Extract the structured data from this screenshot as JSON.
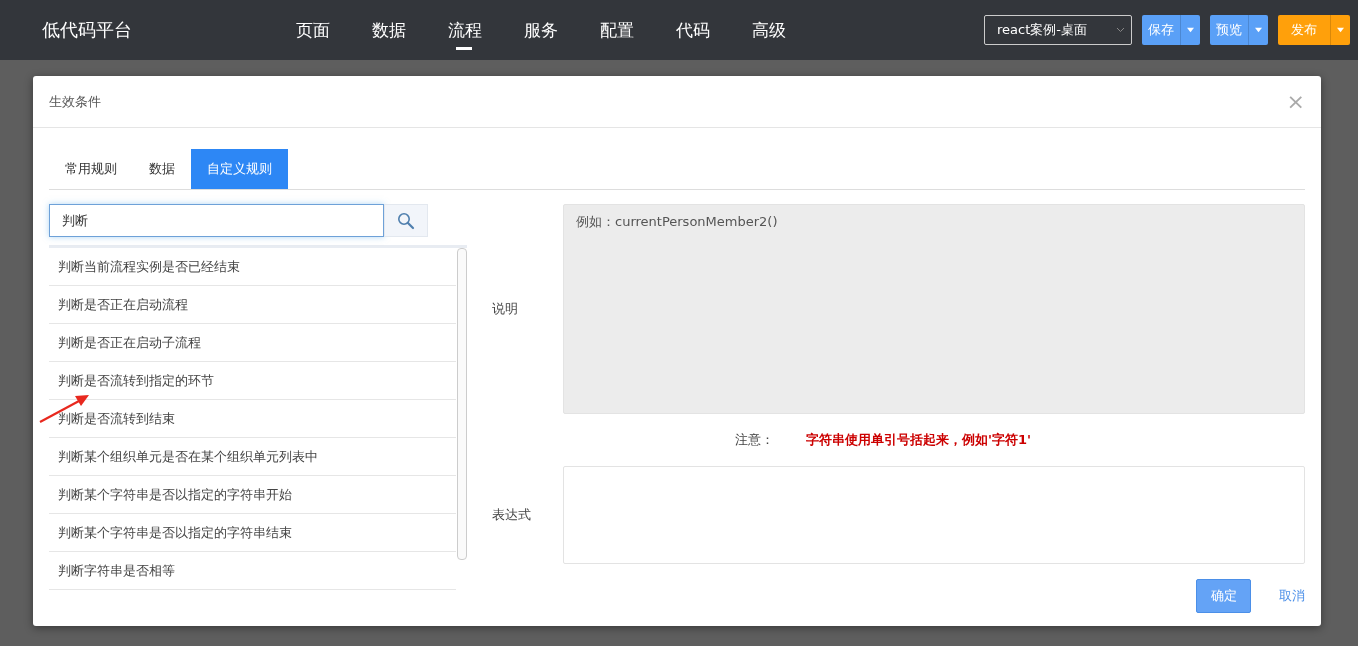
{
  "app": {
    "title": "低代码平台"
  },
  "nav": [
    {
      "label": "页面",
      "selected": false
    },
    {
      "label": "数据",
      "selected": false
    },
    {
      "label": "流程",
      "selected": true
    },
    {
      "label": "服务",
      "selected": false
    },
    {
      "label": "配置",
      "selected": false
    },
    {
      "label": "代码",
      "selected": false
    },
    {
      "label": "高级",
      "selected": false
    }
  ],
  "project_select": {
    "value": "react案例-桌面"
  },
  "toolbar_buttons": [
    {
      "label": "保存",
      "kind": "primary"
    },
    {
      "label": "预览",
      "kind": "primary"
    },
    {
      "label": "发布",
      "kind": "warning"
    }
  ],
  "dialog": {
    "title": "生效条件",
    "close": "×",
    "tabs": [
      {
        "label": "常用规则",
        "selected": false
      },
      {
        "label": "数据",
        "selected": false
      },
      {
        "label": "自定义规则",
        "selected": true
      }
    ],
    "search": {
      "value": "判断"
    },
    "functions": [
      "判断当前流程实例是否已经结束",
      "判断是否正在启动流程",
      "判断是否正在启动子流程",
      "判断是否流转到指定的环节",
      "判断是否流转到结束",
      "判断某个组织单元是否在某个组织单元列表中",
      "判断某个字符串是否以指定的字符串开始",
      "判断某个字符串是否以指定的字符串结束",
      "判断字符串是否相等"
    ],
    "description": {
      "label": "说明",
      "placeholder": "例如：currentPersonMember2()"
    },
    "note": {
      "label": "注意：",
      "text": "字符串使用单引号括起来，例如'字符1'"
    },
    "expression": {
      "label": "表达式"
    },
    "buttons": [
      {
        "label": "确定",
        "kind": "primary"
      },
      {
        "label": "取消",
        "kind": "link"
      }
    ]
  }
}
